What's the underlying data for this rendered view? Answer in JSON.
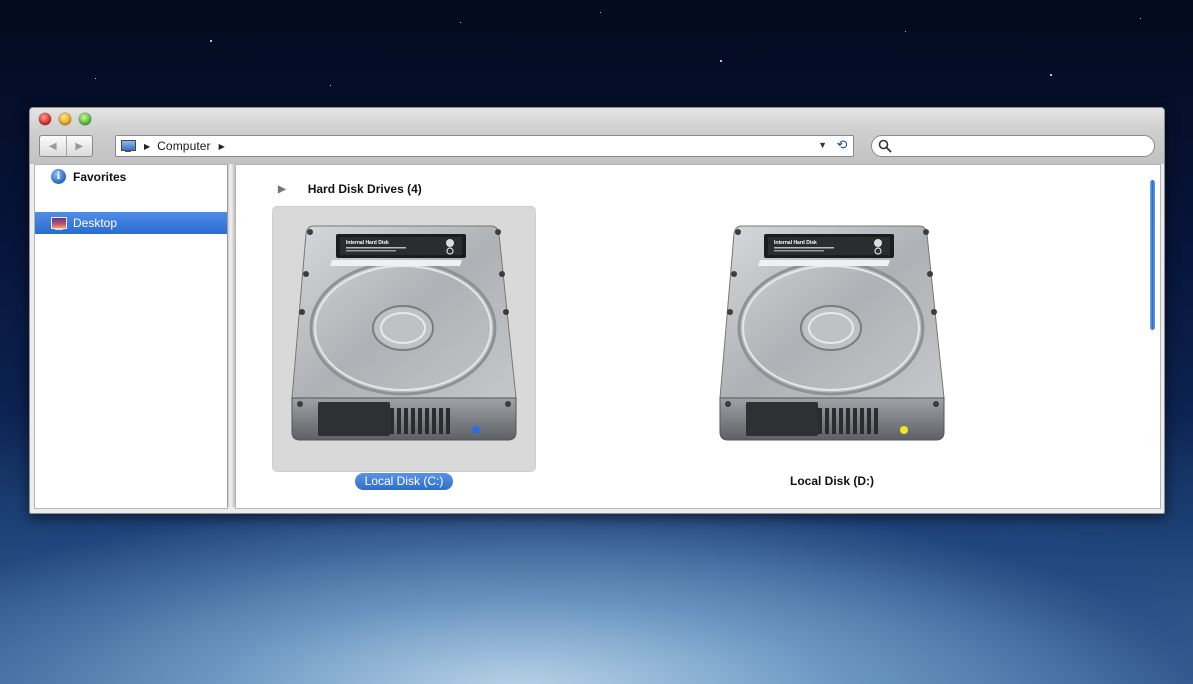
{
  "window": {
    "traffic_lights": [
      "close",
      "minimize",
      "zoom"
    ]
  },
  "toolbar": {
    "back_icon": "back-arrow",
    "forward_icon": "forward-arrow",
    "address": {
      "location": "Computer",
      "icon": "computer-icon"
    },
    "search": {
      "placeholder": "",
      "icon": "search-icon"
    }
  },
  "sidebar": {
    "favorites_label": "Favorites",
    "items": [
      {
        "label": "Desktop",
        "icon": "desktop-icon",
        "selected": true
      }
    ]
  },
  "main": {
    "group_header": "Hard Disk Drives (4)",
    "drives": [
      {
        "label": "Local Disk (C:)",
        "selected": true,
        "led_color": "#2a6fe0"
      },
      {
        "label": "Local Disk (D:)",
        "selected": false,
        "led_color": "#f2e324"
      }
    ]
  },
  "colors": {
    "selection": "#2f6ccc"
  }
}
